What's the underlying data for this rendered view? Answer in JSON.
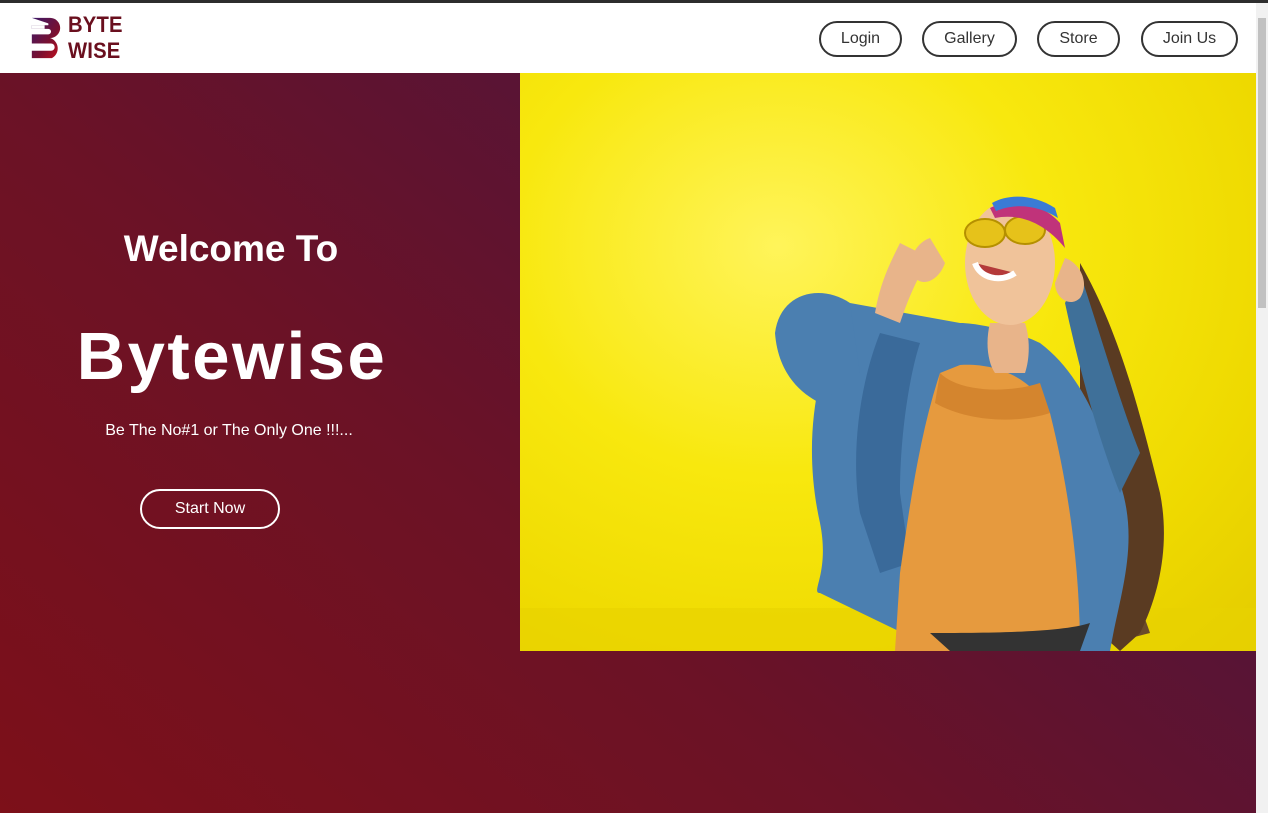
{
  "brand": {
    "logo_text": "BYTE WISE",
    "logo_icon": "b-logo-icon",
    "colors": {
      "primary": "#6a0f1e",
      "accent": "#3b1a5a"
    }
  },
  "nav": {
    "items": [
      {
        "label": "Login"
      },
      {
        "label": "Gallery"
      },
      {
        "label": "Store"
      },
      {
        "label": "Join Us"
      }
    ]
  },
  "hero": {
    "welcome": "Welcome To",
    "title": "Bytewise",
    "tagline": "Be The No#1 or The Only One !!!...",
    "cta_label": "Start Now",
    "gradient_colors": [
      "#7d1019",
      "#3d1343"
    ],
    "image_subject": "woman-yellow-wall-photo"
  }
}
